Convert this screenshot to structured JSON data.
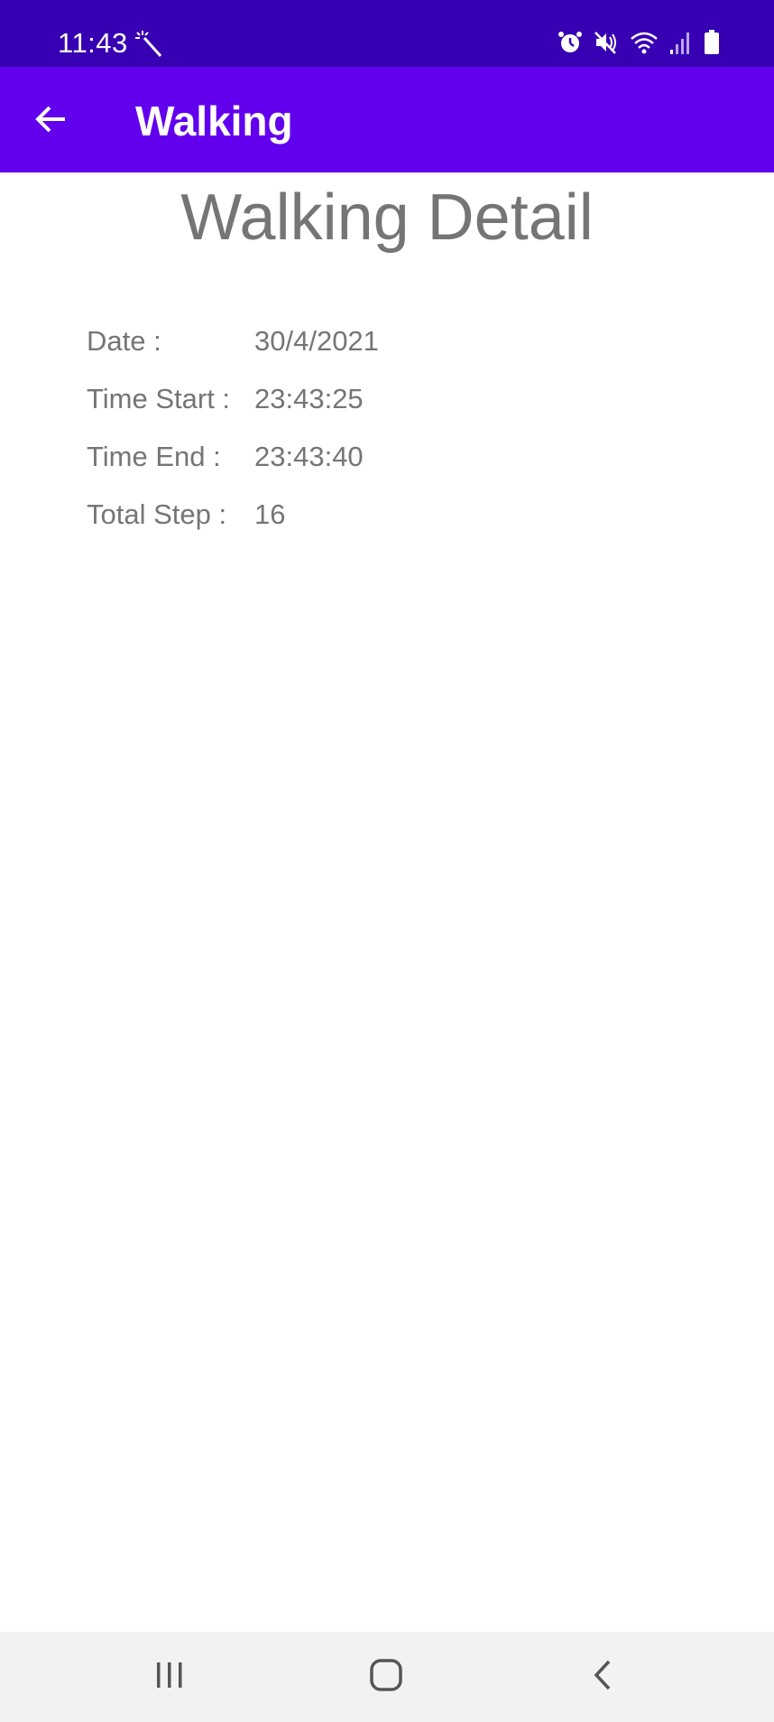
{
  "status_bar": {
    "time": "11:43",
    "icons": [
      "magic-wand-icon",
      "alarm-icon",
      "mute-icon",
      "wifi-icon",
      "signal-icon",
      "battery-icon"
    ]
  },
  "app_bar": {
    "title": "Walking",
    "back_icon": "arrow-left-icon",
    "background": "#6200EE"
  },
  "colors": {
    "status_bar": "#3700B3",
    "text_secondary": "#757575"
  },
  "detail": {
    "heading": "Walking Detail",
    "rows": [
      {
        "label": "Date :",
        "value": "30/4/2021"
      },
      {
        "label": "Time Start :",
        "value": "23:43:25"
      },
      {
        "label": "Time End :",
        "value": "23:43:40"
      },
      {
        "label": "Total Step :",
        "value": "16"
      }
    ]
  },
  "nav_bar": {
    "buttons": [
      "recent-apps-icon",
      "home-icon",
      "back-icon"
    ]
  }
}
